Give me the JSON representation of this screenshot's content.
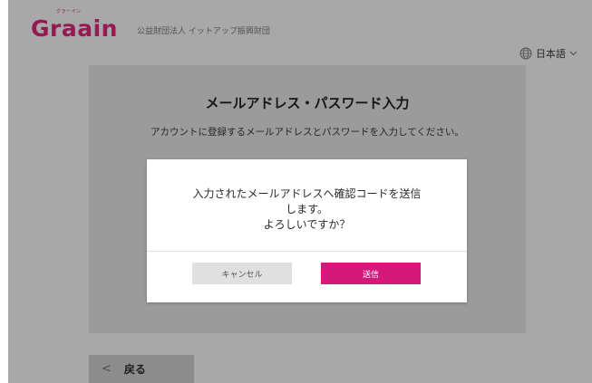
{
  "header": {
    "logo_text": "Graain",
    "logo_ruby": "グラーイン",
    "org_name": "公益財団法人 イットアップ振興財団",
    "language_label": "日本語",
    "icons": [
      "globe-icon",
      "chevron-down-icon"
    ]
  },
  "card": {
    "title": "メールアドレス・パスワード入力",
    "description": "アカウントに登録するメールアドレスとパスワードを入力してください。"
  },
  "modal": {
    "message_line1": "入力されたメールアドレスへ確認コードを送信",
    "message_line2": "します。",
    "message_line3": "よろしいですか？",
    "cancel_label": "キャンセル",
    "send_label": "送信"
  },
  "footer": {
    "back_label": "戻る",
    "back_icon": "chevron-left-icon"
  },
  "colors": {
    "brand": "#951a53",
    "primary_button": "#d7187b",
    "overlay": "#a8a8a8"
  }
}
